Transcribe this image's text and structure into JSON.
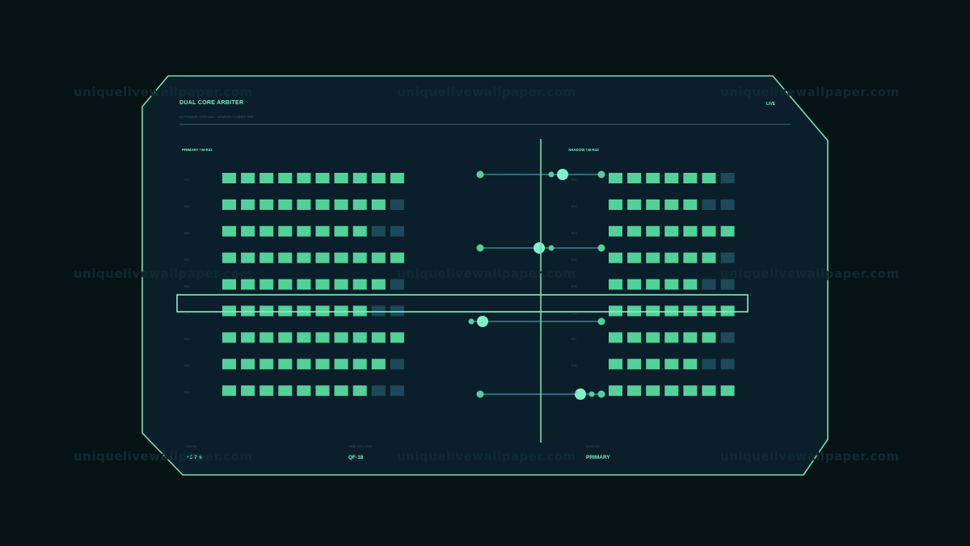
{
  "header": {
    "title": "DUAL CORE ARBITER",
    "subtitle": "ALTERNATE STEP-ING / NEWS BY / 1 DEEP SEE",
    "status": "LIVE"
  },
  "zones": [
    {
      "label": "PRIMARY / M-R41",
      "rows": [
        {
          "label": "R01",
          "active": 10,
          "total": 10
        },
        {
          "label": "R02",
          "active": 9,
          "total": 10
        },
        {
          "label": "R03",
          "active": 8,
          "total": 10
        },
        {
          "label": "R04",
          "active": 10,
          "total": 10
        },
        {
          "label": "R05",
          "active": 9,
          "total": 10
        },
        {
          "label": "R06",
          "active": 8,
          "total": 10
        },
        {
          "label": "R07",
          "active": 10,
          "total": 10
        },
        {
          "label": "R08",
          "active": 9,
          "total": 10
        },
        {
          "label": "R09",
          "active": 8,
          "total": 10
        }
      ]
    },
    {
      "label": "SHADOW / M-R42",
      "rows": [
        {
          "label": "R01",
          "active": 6,
          "total": 7
        },
        {
          "label": "R02",
          "active": 5,
          "total": 7
        },
        {
          "label": "R03",
          "active": 7,
          "total": 7
        },
        {
          "label": "R04",
          "active": 6,
          "total": 7
        },
        {
          "label": "R05",
          "active": 5,
          "total": 7
        },
        {
          "label": "R06",
          "active": 7,
          "total": 7
        },
        {
          "label": "R07",
          "active": 6,
          "total": 7
        },
        {
          "label": "R08",
          "active": 5,
          "total": 7
        },
        {
          "label": "R09",
          "active": 7,
          "total": 7
        }
      ]
    }
  ],
  "stats": [
    {
      "label": "DELTA",
      "value": "+0.7%"
    },
    {
      "label": "ARBITER LOAD",
      "value": "QF-18"
    },
    {
      "label": "MASTER",
      "value": "PRIMARY"
    }
  ],
  "watermark": "uniquelivewallpaper.com",
  "colors": {
    "background": "#061314",
    "panel": "#0b1f2a",
    "border": "#6ee0b0",
    "cell_active": "#52d199",
    "cell_inactive": "#1c4a5a",
    "accent": "#7ff0c8"
  }
}
